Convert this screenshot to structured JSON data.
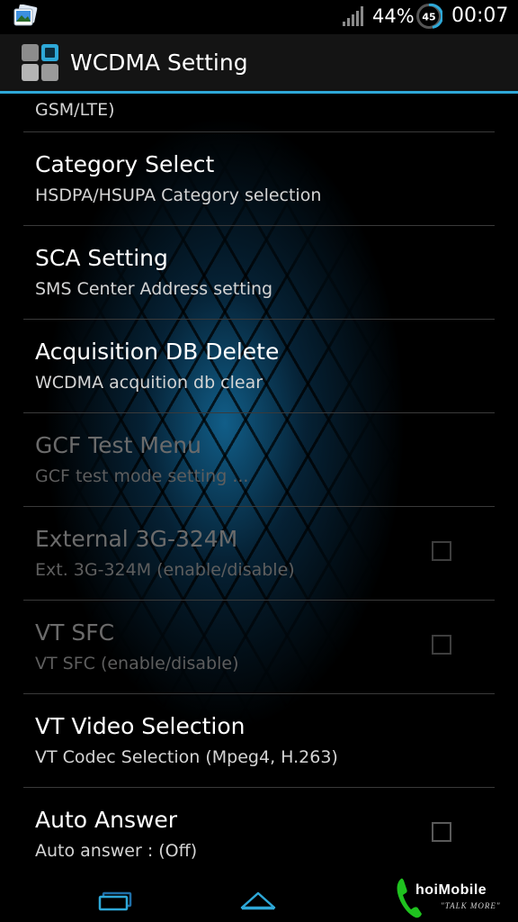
{
  "status_bar": {
    "notification_icon": "picture-notification-icon",
    "signal_icon": "signal-strength-icon",
    "battery_percent": "44%",
    "battery_badge": "45",
    "time": "00:07"
  },
  "action_bar": {
    "icon": "app-grid-icon",
    "title": "WCDMA Setting",
    "accent_color": "#2ea8d8"
  },
  "list": {
    "partial_item": {
      "summary": "GSM/LTE)"
    },
    "items": [
      {
        "title": "Category Select",
        "summary": "HSDPA/HSUPA Category selection",
        "enabled": true,
        "has_checkbox": false
      },
      {
        "title": "SCA Setting",
        "summary": "SMS Center Address setting",
        "enabled": true,
        "has_checkbox": false
      },
      {
        "title": "Acquisition DB Delete",
        "summary": "WCDMA acquition db clear",
        "enabled": true,
        "has_checkbox": false
      },
      {
        "title": "GCF Test Menu",
        "summary": "GCF test mode setting ...",
        "enabled": false,
        "has_checkbox": false
      },
      {
        "title": "External 3G-324M",
        "summary": "Ext. 3G-324M (enable/disable)",
        "enabled": false,
        "has_checkbox": true,
        "checked": false
      },
      {
        "title": "VT SFC",
        "summary": "VT SFC (enable/disable)",
        "enabled": false,
        "has_checkbox": true,
        "checked": false
      },
      {
        "title": "VT Video Selection",
        "summary": "VT Codec Selection (Mpeg4, H.263)",
        "enabled": true,
        "has_checkbox": false
      },
      {
        "title": "Auto Answer",
        "summary": "Auto answer : (Off)",
        "enabled": true,
        "has_checkbox": true,
        "checked": false
      }
    ]
  },
  "nav_bar": {
    "recents_icon": "recent-apps-icon",
    "home_icon": "home-icon"
  },
  "watermark": {
    "brand": "hoiMobile",
    "tagline": "\"TALK MORE\""
  }
}
